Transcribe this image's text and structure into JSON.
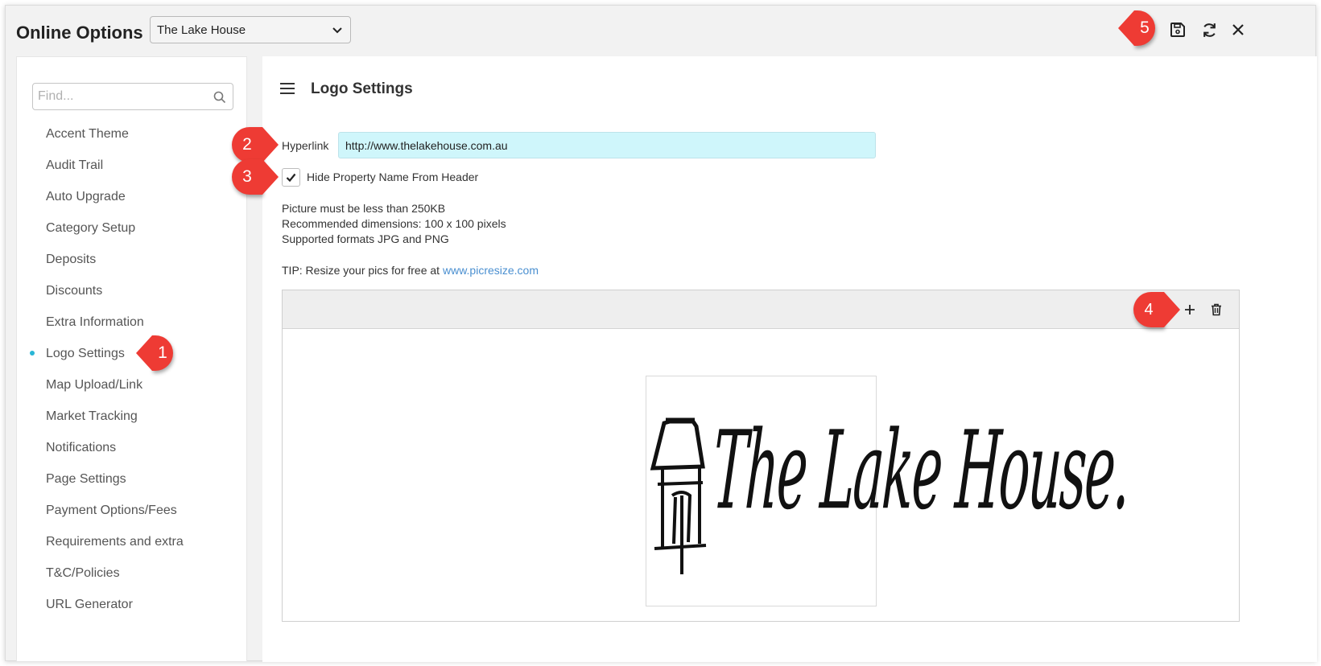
{
  "header": {
    "title": "Online Options",
    "property_selected": "The Lake House",
    "icons": [
      "save-icon",
      "refresh-icon",
      "close-icon"
    ]
  },
  "sidebar": {
    "search_placeholder": "Find...",
    "items": [
      {
        "label": "Accent Theme"
      },
      {
        "label": "Audit Trail"
      },
      {
        "label": "Auto Upgrade"
      },
      {
        "label": "Category Setup"
      },
      {
        "label": "Deposits"
      },
      {
        "label": "Discounts"
      },
      {
        "label": "Extra Information"
      },
      {
        "label": "Logo Settings",
        "active": true
      },
      {
        "label": "Map Upload/Link"
      },
      {
        "label": "Market Tracking"
      },
      {
        "label": "Notifications"
      },
      {
        "label": "Page Settings"
      },
      {
        "label": "Payment Options/Fees"
      },
      {
        "label": "Requirements and extra"
      },
      {
        "label": "T&C/Policies"
      },
      {
        "label": "URL Generator"
      }
    ]
  },
  "main": {
    "title": "Logo Settings",
    "hyperlink_label": "Hyperlink",
    "hyperlink_value": "http://www.thelakehouse.com.au",
    "hide_name_label": "Hide Property Name From Header",
    "hide_name_checked": true,
    "info_lines": [
      "Picture must be less than 250KB",
      "Recommended dimensions: 100 x 100 pixels",
      "Supported formats JPG and PNG"
    ],
    "tip_prefix": "TIP: Resize your pics for free at",
    "tip_link": "www.picresize.com",
    "logo_text": "The Lake House."
  },
  "callouts": [
    "1",
    "2",
    "3",
    "4",
    "5"
  ],
  "colors": {
    "accent": "#29b6d6",
    "callout": "#ee3b34",
    "hyperlink_bg": "#cff6fb",
    "link": "#4a8fd0"
  }
}
